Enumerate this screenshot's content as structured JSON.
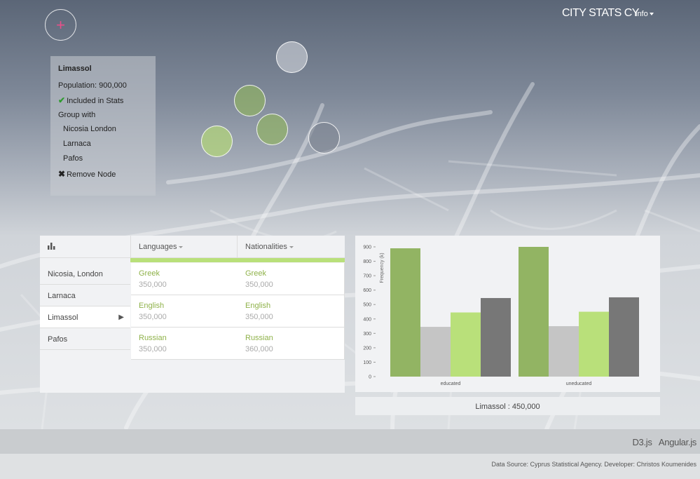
{
  "header": {
    "brand": "CITY STATS CY",
    "info_menu": "info"
  },
  "add_button": {
    "symbol": "+"
  },
  "map": {
    "nodes": [
      {
        "name": "node-1"
      },
      {
        "name": "node-2"
      },
      {
        "name": "node-3"
      },
      {
        "name": "node-4"
      },
      {
        "name": "node-5"
      }
    ]
  },
  "info_panel": {
    "title": "Limassol",
    "population": "Population: 900,000",
    "included": "Included in Stats",
    "group_with": "Group with",
    "groups": [
      "Nicosia London",
      "Larnaca",
      "Pafos"
    ],
    "remove": "Remove Node"
  },
  "table": {
    "columns": [
      "Languages",
      "Nationalities"
    ],
    "cities": [
      "Nicosia, London",
      "Larnaca",
      "Limassol",
      "Pafos"
    ],
    "active_city": "Limassol",
    "languages": [
      {
        "label": "Greek",
        "value": "350,000"
      },
      {
        "label": "English",
        "value": "350,000"
      },
      {
        "label": "Russian",
        "value": "350,000"
      }
    ],
    "nationalities": [
      {
        "label": "Greek",
        "value": "350,000"
      },
      {
        "label": "English",
        "value": "350,000"
      },
      {
        "label": "Russian",
        "value": "360,000"
      }
    ]
  },
  "chart_data": {
    "type": "bar",
    "categories": [
      "educated",
      "uneducated"
    ],
    "ylabel": "Frequency (k)",
    "ylim": [
      0,
      900
    ],
    "yticks": [
      0,
      100,
      200,
      300,
      400,
      500,
      600,
      700,
      800,
      900
    ],
    "series": [
      {
        "values": [
          890,
          900
        ],
        "color": "#92b463"
      },
      {
        "values": [
          345,
          350
        ],
        "color": "#c5c5c5"
      },
      {
        "values": [
          445,
          450
        ],
        "color": "#b9e07a"
      },
      {
        "values": [
          545,
          550
        ],
        "color": "#777777"
      }
    ],
    "grid": false
  },
  "chart_caption": "Limassol : 450,000",
  "footer": {
    "links": [
      "D3.js",
      "Angular.js"
    ],
    "credits": "Data Source: Cyprus Statistical Agency. Developer: Christos Koumenides"
  },
  "colors": {
    "accent_pink": "#e8508a",
    "green": "#92b463",
    "light_green": "#b9e07a"
  }
}
